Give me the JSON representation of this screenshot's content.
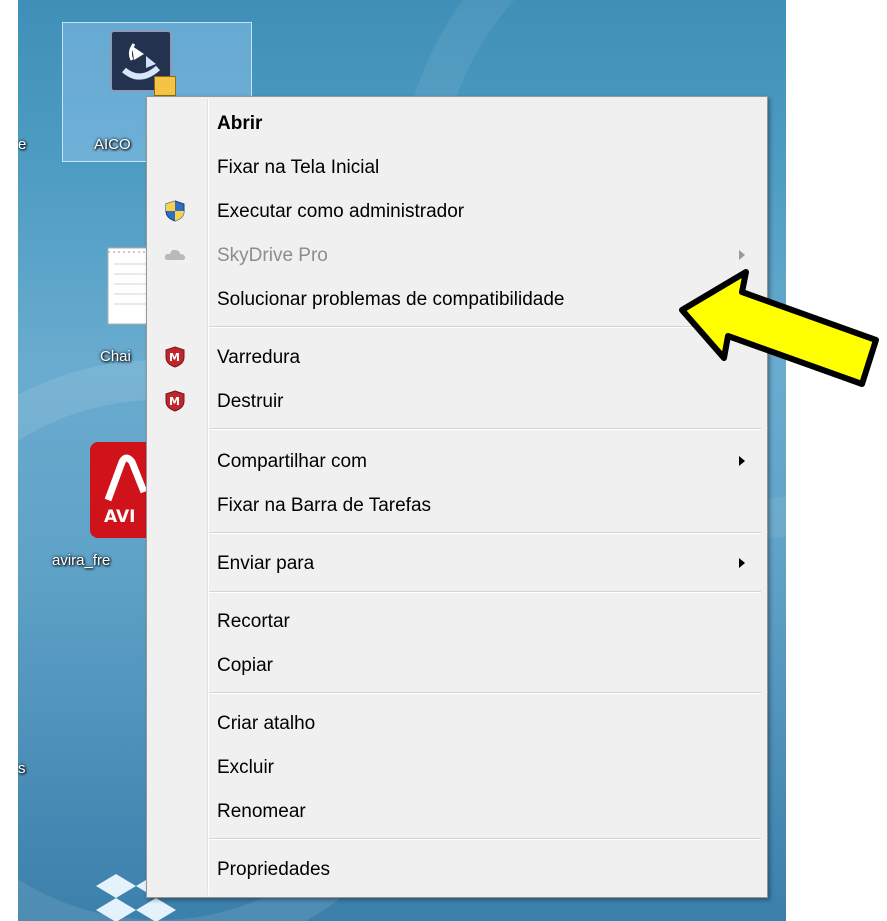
{
  "desktop": {
    "icons": [
      {
        "label": "AICO",
        "name": "aico-shortcut"
      },
      {
        "label": "Chai",
        "name": "notepad-file"
      },
      {
        "label": "avira_fre",
        "name": "avira-installer"
      }
    ],
    "edge_labels": [
      "e",
      "s"
    ]
  },
  "menu": {
    "items": [
      {
        "label": "Abrir"
      },
      {
        "label": "Fixar na Tela Inicial"
      },
      {
        "label": "Executar como administrador",
        "icon": "uac-shield-icon"
      },
      {
        "label": "SkyDrive Pro",
        "icon": "skydrive-cloud-icon"
      },
      {
        "label": "Solucionar problemas de compatibilidade"
      },
      {
        "label": "Varredura",
        "icon": "mcafee-shield-icon"
      },
      {
        "label": "Destruir",
        "icon": "mcafee-shield-icon"
      },
      {
        "label": "Compartilhar com"
      },
      {
        "label": "Fixar na Barra de Tarefas"
      },
      {
        "label": "Enviar para"
      },
      {
        "label": "Recortar"
      },
      {
        "label": "Copiar"
      },
      {
        "label": "Criar atalho"
      },
      {
        "label": "Excluir"
      },
      {
        "label": "Renomear"
      },
      {
        "label": "Propriedades"
      }
    ]
  },
  "annotation": {
    "icon": "yellow-arrow-icon",
    "color": "#ffff00"
  }
}
